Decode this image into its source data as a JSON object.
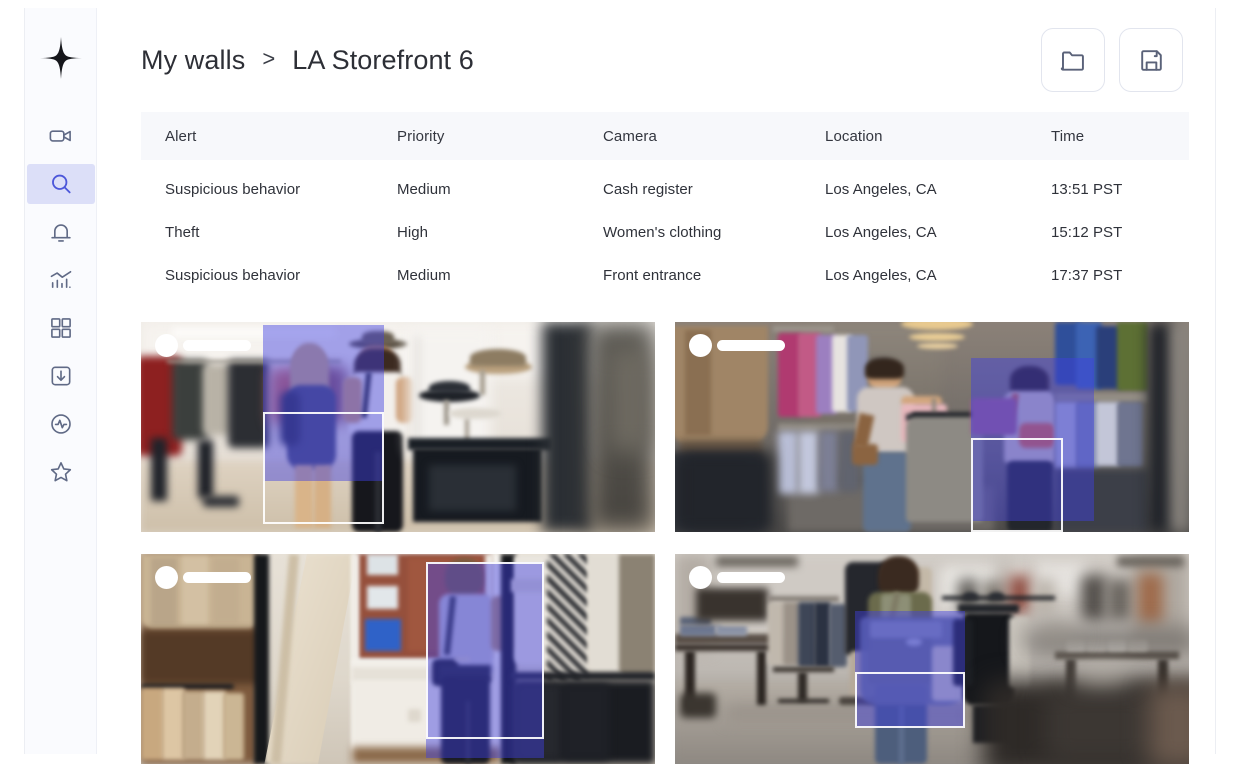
{
  "app": {
    "logo_icon": "four-point-star-logo"
  },
  "sidebar": {
    "items": [
      {
        "icon": "video-camera-icon",
        "name": "cameras",
        "active": false
      },
      {
        "icon": "search-icon",
        "name": "search",
        "active": true
      },
      {
        "icon": "bell-icon",
        "name": "alerts",
        "active": false
      },
      {
        "icon": "bar-chart-icon",
        "name": "analytics",
        "active": false
      },
      {
        "icon": "grid-icon",
        "name": "walls",
        "active": false
      },
      {
        "icon": "download-icon",
        "name": "downloads",
        "active": false
      },
      {
        "icon": "activity-icon",
        "name": "health",
        "active": false
      },
      {
        "icon": "star-icon",
        "name": "favorites",
        "active": false
      }
    ]
  },
  "header": {
    "breadcrumb": {
      "parent": "My walls",
      "separator": ">",
      "current": "LA Storefront 6"
    },
    "actions": [
      {
        "label": "Open folder",
        "icon": "folder-icon"
      },
      {
        "label": "Save",
        "icon": "save-disk-icon"
      }
    ]
  },
  "alerts_table": {
    "columns": [
      "Alert",
      "Priority",
      "Camera",
      "Location",
      "Time"
    ],
    "rows": [
      {
        "alert": "Suspicious behavior",
        "priority": "Medium",
        "camera": "Cash register",
        "location": "Los Angeles, CA",
        "time": "13:51 PST"
      },
      {
        "alert": "Theft",
        "priority": "High",
        "camera": "Women's clothing",
        "location": "Los Angeles, CA",
        "time": "15:12 PST"
      },
      {
        "alert": "Suspicious behavior",
        "priority": "Medium",
        "camera": "Front entrance",
        "location": "Los Angeles, CA",
        "time": "17:37 PST"
      }
    ]
  },
  "video_grid": {
    "tiles": [
      {
        "name": "camera-tile-1",
        "scene": "bright boutique interior with two women browsing hats and clothing racks",
        "label_redacted": true,
        "tracking_overlay": true
      },
      {
        "name": "camera-tile-2",
        "scene": "menswear aisle with man holding shirt and woman with orange bag",
        "label_redacted": true,
        "tracking_overlay": true
      },
      {
        "name": "camera-tile-3",
        "scene": "boutique near street window with woman wearing crossbody bag",
        "label_redacted": true,
        "tracking_overlay": true
      },
      {
        "name": "camera-tile-4",
        "scene": "department store with woman carrying garments past racks",
        "label_redacted": true,
        "tracking_overlay": true
      }
    ]
  },
  "colors": {
    "accent": "#4c57da",
    "accent_bg": "#dcdff8",
    "icon": "#606a86",
    "text": "#2f323a",
    "table_header_bg": "#f7f8fb",
    "sidebar_bg": "#fafbfe",
    "tracking_overlay": "#4040e0"
  }
}
